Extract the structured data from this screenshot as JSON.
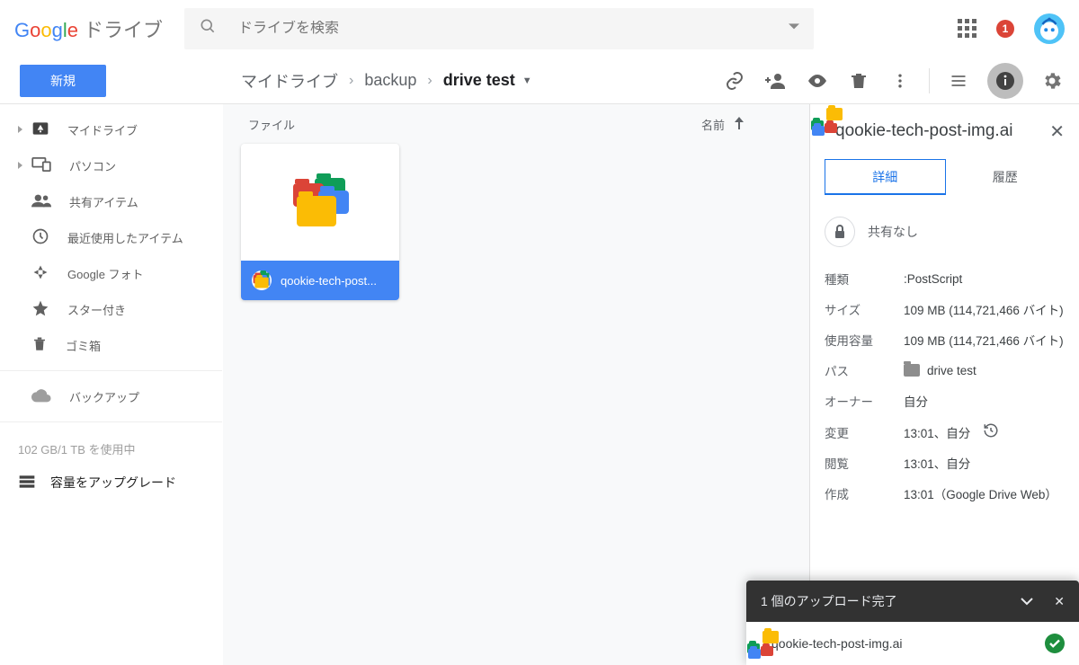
{
  "header": {
    "product": "ドライブ",
    "search_placeholder": "ドライブを検索",
    "notif_count": "1"
  },
  "toolbar": {
    "new_label": "新規"
  },
  "breadcrumbs": {
    "items": [
      "マイドライブ",
      "backup",
      "drive test"
    ]
  },
  "sidebar": {
    "items": [
      {
        "label": "マイドライブ"
      },
      {
        "label": "パソコン"
      },
      {
        "label": "共有アイテム"
      },
      {
        "label": "最近使用したアイテム"
      },
      {
        "label": "Google フォト"
      },
      {
        "label": "スター付き"
      },
      {
        "label": "ゴミ箱"
      },
      {
        "label": "バックアップ"
      }
    ],
    "storage_text": "102 GB/1 TB を使用中",
    "upgrade_label": "容量をアップグレード"
  },
  "main": {
    "section_label": "ファイル",
    "sort_label": "名前",
    "file": {
      "name": "qookie-tech-post..."
    }
  },
  "details": {
    "filename": "qookie-tech-post-img.ai",
    "tabs": {
      "details": "詳細",
      "activity": "履歴"
    },
    "share_status": "共有なし",
    "props": {
      "type_k": "種類",
      "type_v": ":PostScript",
      "size_k": "サイズ",
      "size_v": "109 MB (114,721,466 バイト)",
      "used_k": "使用容量",
      "used_v": "109 MB (114,721,466 バイト)",
      "path_k": "パス",
      "path_v": "drive test",
      "owner_k": "オーナー",
      "owner_v": "自分",
      "modified_k": "変更",
      "modified_v": "13:01、自分",
      "viewed_k": "閲覧",
      "viewed_v": "13:01、自分",
      "created_k": "作成",
      "created_v": "13:01（Google Drive Web）"
    }
  },
  "toast": {
    "header": "1 個のアップロード完了",
    "item": "qookie-tech-post-img.ai"
  }
}
